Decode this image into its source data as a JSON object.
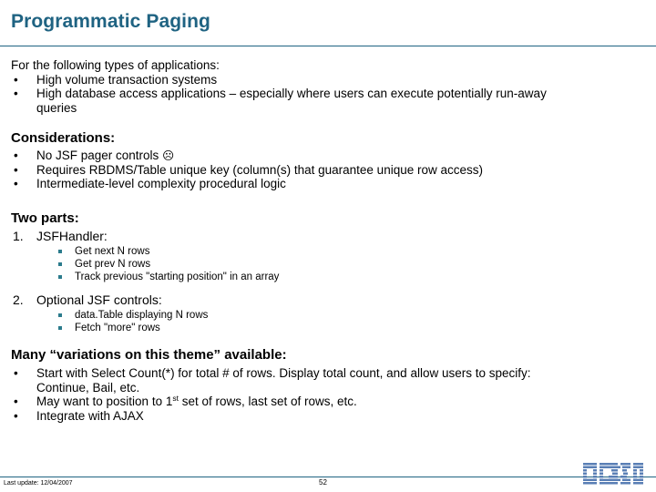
{
  "slide": {
    "title": "Programmatic Paging",
    "accent_color": "#1F6382",
    "bullet_accent_color": "#2B7B8C",
    "logo_color": "#5A7FB5"
  },
  "intro": {
    "lead": "For the following types of applications:",
    "bullets": [
      "High volume transaction systems",
      "High database access applications – especially where users can execute potentially run-away",
      "queries"
    ]
  },
  "considerations": {
    "heading": "Considerations:",
    "bullets": [
      "No JSF pager controls",
      "Requires RBDMS/Table unique key (column(s) that guarantee unique row access)",
      "Intermediate-level complexity procedural logic"
    ],
    "emoji": "☹"
  },
  "two_parts": {
    "heading": "Two parts:",
    "items": [
      {
        "number": "1.",
        "label": "JSFHandler:",
        "subs": [
          "Get next N rows",
          "Get prev N rows",
          "Track previous \"starting position\" in an array"
        ]
      },
      {
        "number": "2.",
        "label": "Optional JSF controls:",
        "subs": [
          "data.Table displaying N rows",
          "Fetch \"more\" rows"
        ]
      }
    ]
  },
  "variations": {
    "heading": "Many “variations on this theme” available:",
    "bullets": [
      {
        "line1": "Start with Select Count(*) for total # of rows.  Display total count, and allow users to specify:",
        "line2": "Continue, Bail, etc."
      },
      {
        "pre": "May want to position to 1",
        "sup": "st",
        "post": " set of rows, last set of rows, etc."
      },
      {
        "line1": "Integrate with AJAX"
      }
    ]
  },
  "footer": {
    "last_update": "Last update: 12/04/2007",
    "page_number": "52",
    "logo_alt": "IBM"
  }
}
